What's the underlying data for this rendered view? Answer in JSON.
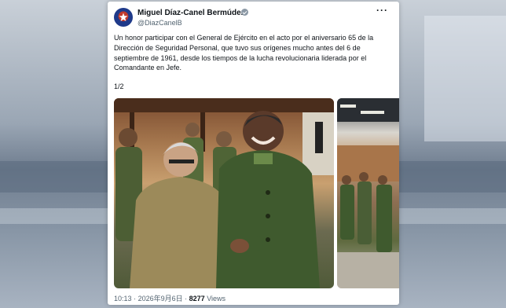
{
  "post": {
    "author_name": "Miguel Díaz-Canel Bermúdez",
    "author_handle": "@DiazCanelB",
    "more_label": "···",
    "text": "Un honor participar con el General de Ejército en el acto por el aniversario 65 de la Dirección de Seguridad Personal, que tuvo sus orígenes mucho antes del 6 de septiembre de 1961, desde los tiempos de la lucha revolucionaria liderada por el Comandante en Jefe.",
    "media_counter": "1/2",
    "time": "10:13",
    "date": "2026年9月6日",
    "separator": "·",
    "views_count": "8277",
    "views_label": "Views"
  },
  "icons": {
    "avatar": "flag-avatar",
    "verified": "verified-badge-icon",
    "more": "more-options-icon"
  },
  "colors": {
    "text_primary": "#0f1419",
    "text_secondary": "#536471",
    "uniform_green": "#3f5a2e",
    "uniform_khaki": "#9c8a5a"
  }
}
